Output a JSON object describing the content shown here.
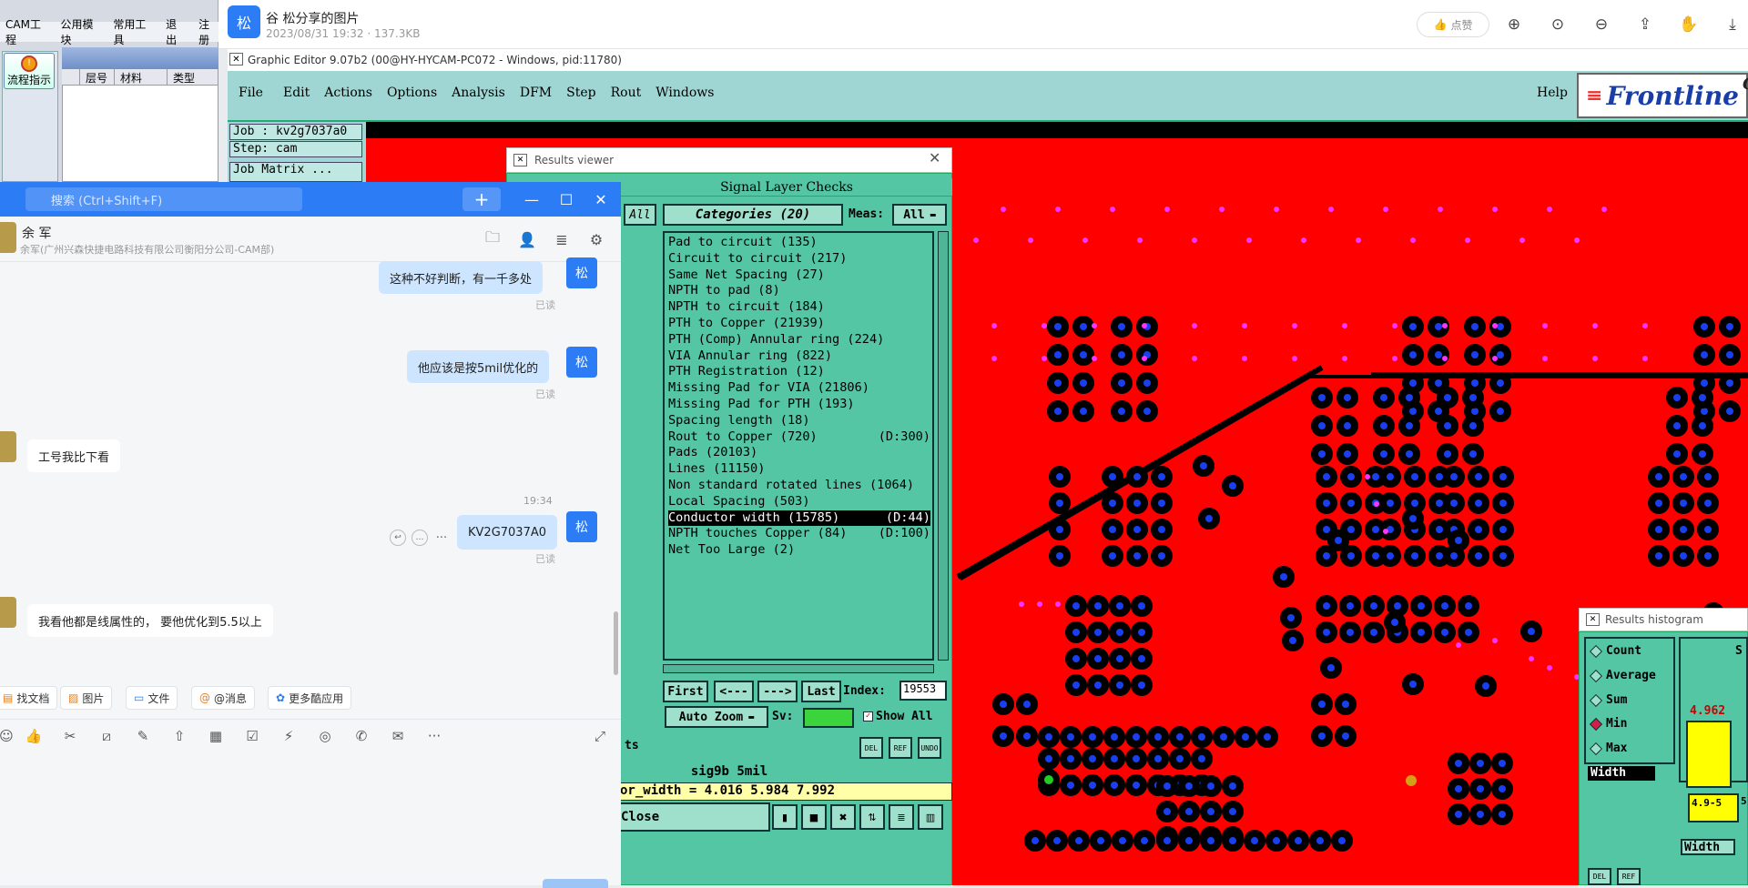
{
  "cam_app": {
    "menu": [
      "CAM工程",
      "公用模块",
      "常用工具",
      "退出",
      "注册"
    ],
    "flow_button": "流程指示",
    "table_headers": [
      "层号",
      "材料",
      "类型"
    ]
  },
  "viewer": {
    "avatar": "松",
    "title": "谷 松分享的图片",
    "subtitle": "2023/08/31 19:32 · 137.3KB",
    "like_label": "点赞",
    "tools": [
      "zoom-in-icon",
      "actual-size-icon",
      "zoom-out-icon",
      "share-icon",
      "hand-icon",
      "download-icon"
    ]
  },
  "graphic_editor": {
    "title": "Graphic Editor 9.07b2 (00@HY-HYCAM-PC072 - Windows, pid:11780)",
    "menu": [
      "File",
      "Edit",
      "Actions",
      "Options",
      "Analysis",
      "DFM",
      "Step",
      "Rout",
      "Windows"
    ],
    "help": "Help",
    "brand": "Frontline",
    "brand_suffix": "G",
    "job": "Job : kv2g7037a0",
    "step": "Step: cam",
    "job_matrix": "Job Matrix ..."
  },
  "results_viewer": {
    "title": "Results viewer",
    "heading": "Signal Layer Checks",
    "all_button": "All",
    "categories_label": "Categories (20)",
    "meas_label": "Meas:",
    "meas_value": "All",
    "items": [
      {
        "label": "Pad to circuit (135)",
        "tag": ""
      },
      {
        "label": "Circuit to circuit (217)",
        "tag": ""
      },
      {
        "label": "Same Net Spacing (27)",
        "tag": ""
      },
      {
        "label": "NPTH to pad (8)",
        "tag": ""
      },
      {
        "label": "NPTH to circuit (184)",
        "tag": ""
      },
      {
        "label": "PTH to Copper (21939)",
        "tag": ""
      },
      {
        "label": "PTH (Comp) Annular ring (224)",
        "tag": ""
      },
      {
        "label": "VIA Annular ring (822)",
        "tag": ""
      },
      {
        "label": "PTH Registration (12)",
        "tag": ""
      },
      {
        "label": "Missing Pad for VIA (21806)",
        "tag": ""
      },
      {
        "label": "Missing Pad for PTH (193)",
        "tag": ""
      },
      {
        "label": "Spacing length (18)",
        "tag": ""
      },
      {
        "label": "Rout to Copper (720)",
        "tag": "(D:300)"
      },
      {
        "label": "Pads (20103)",
        "tag": ""
      },
      {
        "label": "Lines (11150)",
        "tag": ""
      },
      {
        "label": "Non standard rotated lines (1064)",
        "tag": ""
      },
      {
        "label": "Local Spacing (503)",
        "tag": ""
      },
      {
        "label": "Conductor width (15785)",
        "tag": "(D:44)"
      },
      {
        "label": "NPTH touches Copper (84)",
        "tag": "(D:100)"
      },
      {
        "label": "Net Too Large (2)",
        "tag": ""
      }
    ],
    "selected_index": 17,
    "buttons": {
      "first": "First",
      "prev": "<---",
      "next": "--->",
      "last": "Last"
    },
    "index_label": "Index:",
    "index_value": "19553",
    "auto_zoom": "Auto Zoom",
    "sv_label": "Sv:",
    "show_all": "Show All",
    "small_buttons": [
      "DEL",
      "REF",
      "UNDO"
    ],
    "left_partial": "ts",
    "layer_line": "sig9b 5mil",
    "width_line": "or_width = 4.016 5.984 7.992",
    "close": "Close"
  },
  "results_histogram": {
    "title": "Results histogram",
    "options": [
      "Count",
      "Average",
      "Sum",
      "Min",
      "Max"
    ],
    "selected_option": "Min",
    "field": "Width",
    "value": "4.962",
    "range": "4.9-5",
    "range_right": "5",
    "field2": "Width",
    "partial_s": "S",
    "small_buttons": [
      "DEL",
      "REF"
    ]
  },
  "chat": {
    "search_placeholder": "搜索 (Ctrl+Shift+F)",
    "peer_name": "余 军",
    "peer_org": "余军(广州兴森快捷电路科技有限公司衡阳分公司-CAM部)",
    "me_avatar": "松",
    "read_label": "已读",
    "time": "19:34",
    "messages": [
      {
        "from": "me",
        "text": "这种不好判断，有一千多处"
      },
      {
        "from": "me",
        "text": "他应该是按5mil优化的"
      },
      {
        "from": "peer",
        "text": "工号我比下看"
      },
      {
        "from": "me",
        "text": "KV2G7037A0"
      },
      {
        "from": "peer",
        "text": "我看他都是线属性的，  要他优化到5.5以上"
      }
    ],
    "quick_actions": [
      "找文档",
      "图片",
      "文件",
      "@消息",
      "更多酷应用"
    ]
  },
  "colors": {
    "wecom_blue": "#2b7cf5",
    "cam_green": "#54c6a4",
    "copper_red": "#ff0000"
  }
}
